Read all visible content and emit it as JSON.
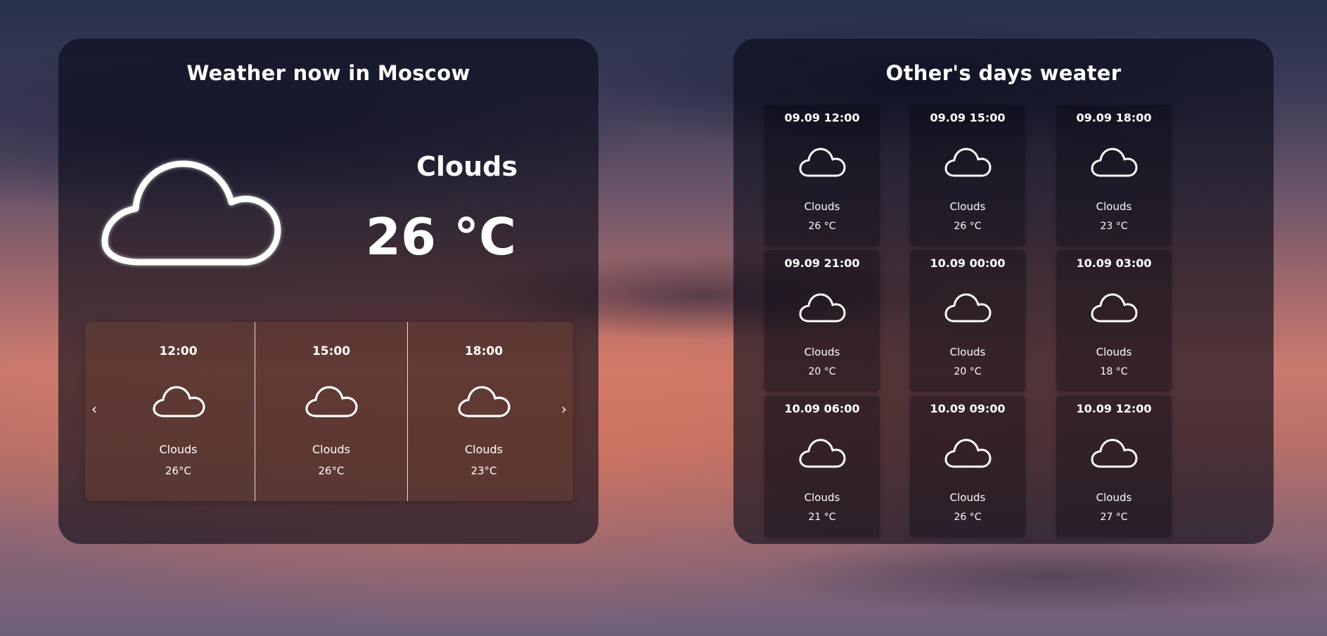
{
  "now": {
    "title": "Weather now in Moscow",
    "description": "Clouds",
    "temperature": "26 °C",
    "icon": "cloud-icon"
  },
  "carousel": {
    "prev_label": "‹",
    "next_label": "›",
    "items": [
      {
        "time": "12:00",
        "icon": "cloud-icon",
        "description": "Clouds",
        "temperature": "26°C"
      },
      {
        "time": "15:00",
        "icon": "cloud-icon",
        "description": "Clouds",
        "temperature": "26°C"
      },
      {
        "time": "18:00",
        "icon": "cloud-icon",
        "description": "Clouds",
        "temperature": "23°C"
      }
    ]
  },
  "forecast": {
    "title": "Other's days weater",
    "items": [
      {
        "time": "09.09 12:00",
        "icon": "cloud-icon",
        "description": "Clouds",
        "temperature": "26 °C"
      },
      {
        "time": "09.09 15:00",
        "icon": "cloud-icon",
        "description": "Clouds",
        "temperature": "26 °C"
      },
      {
        "time": "09.09 18:00",
        "icon": "cloud-icon",
        "description": "Clouds",
        "temperature": "23 °C"
      },
      {
        "time": "09.09 21:00",
        "icon": "cloud-icon",
        "description": "Clouds",
        "temperature": "20 °C"
      },
      {
        "time": "10.09 00:00",
        "icon": "cloud-icon",
        "description": "Clouds",
        "temperature": "20 °C"
      },
      {
        "time": "10.09 03:00",
        "icon": "cloud-icon",
        "description": "Clouds",
        "temperature": "18 °C"
      },
      {
        "time": "10.09 06:00",
        "icon": "cloud-icon",
        "description": "Clouds",
        "temperature": "21 °C"
      },
      {
        "time": "10.09 09:00",
        "icon": "cloud-icon",
        "description": "Clouds",
        "temperature": "26 °C"
      },
      {
        "time": "10.09 12:00",
        "icon": "cloud-icon",
        "description": "Clouds",
        "temperature": "27 °C"
      }
    ]
  }
}
